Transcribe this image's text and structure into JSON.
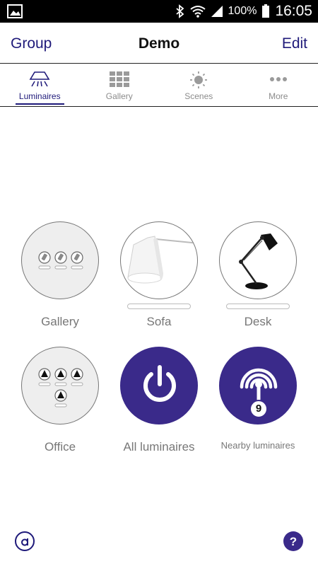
{
  "status": {
    "battery": "100%",
    "time": "16:05"
  },
  "header": {
    "left": "Group",
    "title": "Demo",
    "right": "Edit"
  },
  "tabs": [
    {
      "label": "Luminaires",
      "active": true,
      "icon": "luminaire-icon"
    },
    {
      "label": "Gallery",
      "active": false,
      "icon": "grid-icon"
    },
    {
      "label": "Scenes",
      "active": false,
      "icon": "sun-icon"
    },
    {
      "label": "More",
      "active": false,
      "icon": "more-icon"
    }
  ],
  "tiles": [
    {
      "label": "Gallery",
      "icon": "gallery-group-icon"
    },
    {
      "label": "Sofa",
      "icon": "floor-lamp-icon"
    },
    {
      "label": "Desk",
      "icon": "desk-lamp-icon"
    },
    {
      "label": "Office",
      "icon": "office-group-icon"
    },
    {
      "label": "All luminaires",
      "icon": "power-icon"
    },
    {
      "label": "Nearby luminaires",
      "icon": "signal-icon",
      "badge": "9"
    }
  ],
  "colors": {
    "accent": "#1f1a7a",
    "purple": "#3a2a8a",
    "tile_bg": "#eeeeee"
  }
}
